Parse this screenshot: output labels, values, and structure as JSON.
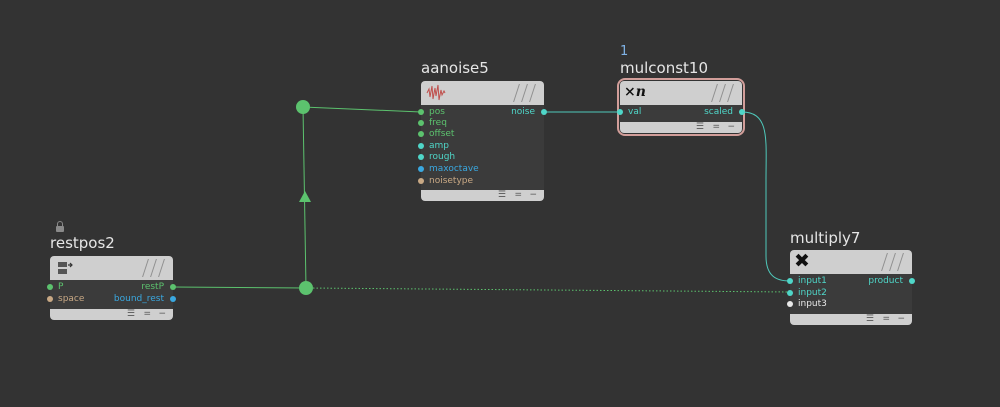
{
  "colors": {
    "background": "#333333",
    "wire_green": "#5cc26e",
    "wire_teal": "#4fc9bb",
    "port_green": "#5cc26e",
    "port_teal": "#4fd6c8",
    "port_blue": "#3aa8e0",
    "port_tan": "#c9a985",
    "port_white": "#e8e8e8",
    "selected_outline": "#d29e9a"
  },
  "nodes": {
    "restpos": {
      "title": "restpos2",
      "icon": "rest-position-icon",
      "inputs": [
        {
          "label": "P",
          "color": "#5cc26e"
        },
        {
          "label": "space",
          "color": "#c9a985"
        }
      ],
      "outputs": [
        {
          "label": "restP",
          "color": "#5cc26e"
        },
        {
          "label": "bound_rest",
          "color": "#3aa8e0"
        }
      ]
    },
    "aanoise": {
      "title": "aanoise5",
      "icon": "noise-wave-icon",
      "inputs": [
        {
          "label": "pos",
          "color": "#5cc26e"
        },
        {
          "label": "freq",
          "color": "#5cc26e"
        },
        {
          "label": "offset",
          "color": "#5cc26e"
        },
        {
          "label": "amp",
          "color": "#4fd6c8"
        },
        {
          "label": "rough",
          "color": "#4fd6c8"
        },
        {
          "label": "maxoctave",
          "color": "#3aa8e0"
        },
        {
          "label": "noisetype",
          "color": "#c9a985"
        }
      ],
      "outputs": [
        {
          "label": "noise",
          "color": "#4fd6c8"
        }
      ]
    },
    "mulconst": {
      "badge": "1",
      "title": "mulconst10",
      "icon_text": "×n",
      "inputs": [
        {
          "label": "val",
          "color": "#4fd6c8"
        }
      ],
      "outputs": [
        {
          "label": "scaled",
          "color": "#4fd6c8"
        }
      ]
    },
    "multiply": {
      "title": "multiply7",
      "icon_text": "✖",
      "inputs": [
        {
          "label": "input1",
          "color": "#4fd6c8"
        },
        {
          "label": "input2",
          "color": "#4fd6c8"
        },
        {
          "label": "input3",
          "color": "#e8e8e8"
        }
      ],
      "outputs": [
        {
          "label": "product",
          "color": "#4fd6c8"
        }
      ]
    }
  },
  "footer_controls": [
    "☰",
    "=",
    "−"
  ]
}
